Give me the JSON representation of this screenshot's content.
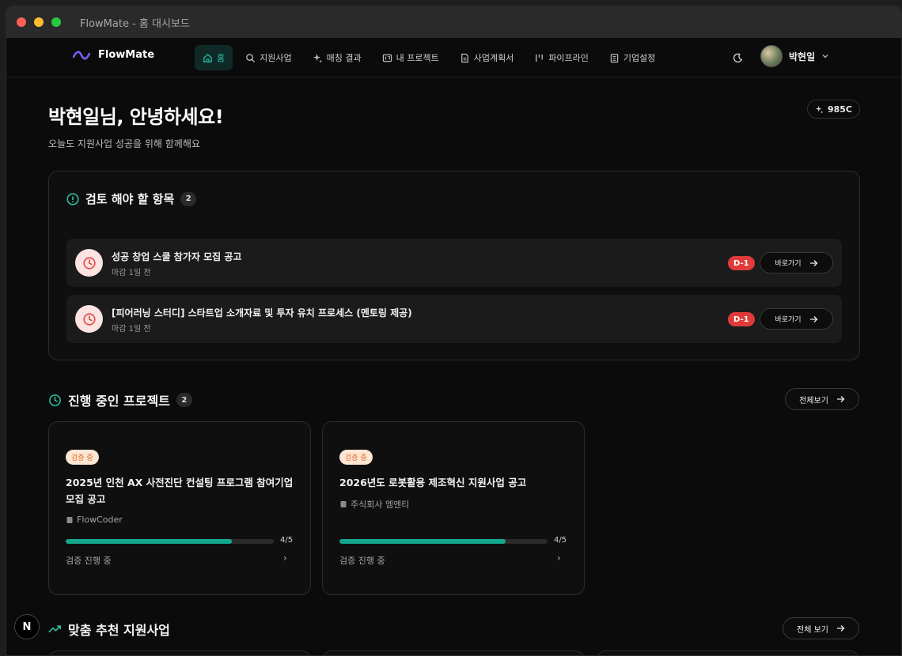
{
  "window": {
    "title": "FlowMate - 홈 대시보드"
  },
  "brand": {
    "name": "FlowMate"
  },
  "nav": {
    "items": [
      {
        "label": "홈",
        "icon": "home-icon",
        "active": true
      },
      {
        "label": "지원사업",
        "icon": "search-icon"
      },
      {
        "label": "매칭 결과",
        "icon": "sparkle-icon"
      },
      {
        "label": "내 프로젝트",
        "icon": "folder-icon"
      },
      {
        "label": "사업계획서",
        "icon": "document-icon"
      },
      {
        "label": "파이프라인",
        "icon": "pipeline-icon"
      },
      {
        "label": "기업설정",
        "icon": "building-icon"
      }
    ],
    "user_name": "박현일"
  },
  "header": {
    "greeting": "박현일님, 안녕하세요!",
    "subtitle": "오늘도 지원사업 성공을 위해 함께해요",
    "credit": "985C"
  },
  "review": {
    "title": "검토 해야 할 항목",
    "count": "2",
    "items": [
      {
        "title": "성공 창업 스쿨 참가자 모집 공고",
        "meta": "마감 1일 전",
        "dday": "D-1",
        "button": "바로가기"
      },
      {
        "title": "[피어러닝 스터디] 스타트업 소개자료 및 투자 유치 프로세스 (멘토링 제공)",
        "meta": "마감 1일 전",
        "dday": "D-1",
        "button": "바로가기"
      }
    ]
  },
  "projects": {
    "title": "진행 중인 프로젝트",
    "count": "2",
    "view_all": "전체보기",
    "items": [
      {
        "status": "검증 중",
        "title": "2025년 인천 AX 사전진단 컨설팅 프로그램 참여기업 모집 공고",
        "org": "FlowCoder",
        "progress": "4/5",
        "progress_fraction": 0.8,
        "state": "검증 진행 중"
      },
      {
        "status": "검증 중",
        "title": "2026년도 로봇활용 제조혁신 지원사업 공고",
        "org": "주식회사 엠엔티",
        "progress": "4/5",
        "progress_fraction": 0.8,
        "state": "검증 진행 중"
      }
    ]
  },
  "recommend": {
    "title": "맞춤 추천 지원사업",
    "view_all": "전체 보기"
  },
  "fab": {
    "label": "N"
  },
  "colors": {
    "accent": "#2bc4a8",
    "danger": "#e03b3b",
    "progress": "#13a88e",
    "status_bg": "#fde6d4",
    "status_text": "#e0702b"
  }
}
